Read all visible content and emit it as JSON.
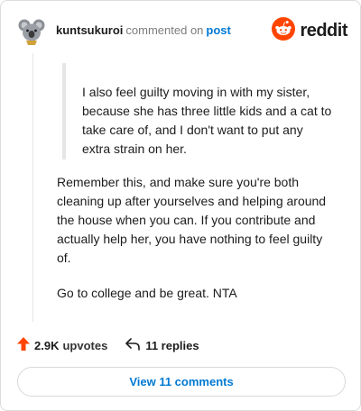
{
  "header": {
    "username": "kuntsukuroi",
    "action_text": "commented on",
    "post_link": "post",
    "brand": "reddit",
    "avatar_icon": "koala-avatar-icon",
    "logo_icon": "reddit-alien-icon",
    "brand_color": "#ff4500"
  },
  "comment": {
    "quote": "I also feel guilty moving in with my sister, because she has three little kids and a cat to take care of, and I don't want to put any extra strain on her.",
    "paragraphs": [
      "Remember this, and make sure you're both cleaning up after yourselves and helping around the house when you can. If you contribute and actually help her, you have nothing to feel guilty of.",
      "Go to college and be great. NTA"
    ]
  },
  "footer": {
    "upvote_count": "2.9K",
    "upvote_label": "upvotes",
    "replies_text": "11 replies",
    "upvote_icon": "upvote-arrow-icon",
    "reply_icon": "reply-arrow-icon"
  },
  "view_comments": {
    "label": "View 11 comments"
  },
  "colors": {
    "link": "#0079d3",
    "upvote": "#ff4500"
  }
}
